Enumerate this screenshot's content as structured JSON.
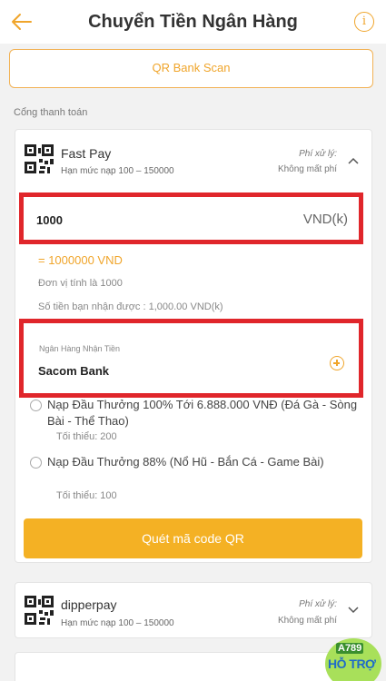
{
  "header": {
    "title": "Chuyển Tiền Ngân Hàng",
    "back_icon": "back-arrow-icon",
    "info_icon": "info-icon",
    "info_glyph": "i"
  },
  "qr_bank_scan": {
    "label": "QR Bank Scan"
  },
  "gateway_section": {
    "label": "Cổng thanh toán"
  },
  "payment_methods": [
    {
      "name": "Fast Pay",
      "limit": "Hạn mức nạp 100 – 150000",
      "fee_label": "Phí xử lý:",
      "fee_value": "Không mất phí",
      "expanded": true
    },
    {
      "name": "dipperpay",
      "limit": "Hạn mức nạp 100 – 150000",
      "fee_label": "Phí xử lý:",
      "fee_value": "Không mất phí",
      "expanded": false
    }
  ],
  "amount": {
    "value": "1000",
    "unit": "VND(k)",
    "converted": "= 1000000 VND",
    "unit_note": "Đơn vị tính là 1000",
    "receive_note": "Số tiền bạn nhận được : 1,000.00 VND(k)"
  },
  "bank": {
    "label": "Ngân Hàng Nhận Tiền",
    "value": "Sacom Bank"
  },
  "promotions": [
    {
      "title": "Nạp Đầu Thưởng 100% Tới 6.888.000 VNĐ (Đá Gà - Sòng Bài - Thể Thao)",
      "min": "Tối thiểu: 200",
      "selected": false
    },
    {
      "title": "Nạp Đầu Thưởng 88% (Nổ Hũ - Bắn Cá - Game Bài)",
      "min": "Tối thiểu: 100",
      "selected": false
    }
  ],
  "scan_qr_button": {
    "label": "Quét mã code QR"
  },
  "support_badge": {
    "top": "A789",
    "bottom": "HỖ TRỢ"
  },
  "colors": {
    "accent": "#f0a52b",
    "button": "#f4b124",
    "highlight_border": "#e0262b",
    "background": "#f2f2f2"
  }
}
